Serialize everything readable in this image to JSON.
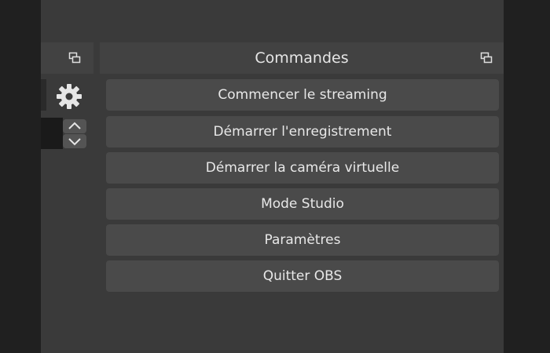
{
  "dock": {
    "title": "Commandes"
  },
  "buttons": [
    {
      "label": "Commencer le streaming"
    },
    {
      "label": "Démarrer l'enregistrement"
    },
    {
      "label": "Démarrer la caméra virtuelle"
    },
    {
      "label": "Mode Studio"
    },
    {
      "label": "Paramètres"
    },
    {
      "label": "Quitter OBS"
    }
  ],
  "colors": {
    "panel_bg": "#3a3a3a",
    "header_bg": "#424242",
    "button_bg": "#4a4a4a",
    "text": "#e8e8e8"
  },
  "icons": {
    "float_left": "dock-float-icon",
    "float_right": "dock-float-icon",
    "settings": "gear-icon",
    "spin_up": "chevron-up-icon",
    "spin_down": "chevron-down-icon"
  }
}
